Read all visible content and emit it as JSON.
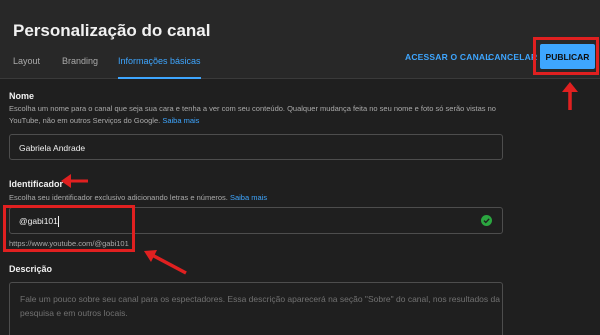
{
  "header": {
    "title": "Personalização do canal",
    "tabs": [
      {
        "label": "Layout",
        "active": false
      },
      {
        "label": "Branding",
        "active": false
      },
      {
        "label": "Informações básicas",
        "active": true
      }
    ],
    "view_channel_label": "ACESSAR O CANAL",
    "cancel_label": "CANCELAR",
    "publish_label": "PUBLICAR"
  },
  "name": {
    "title": "Nome",
    "help_line1": "Escolha um nome para o canal que seja sua cara e tenha a ver com seu conteúdo. Qualquer mudança feita no seu nome e foto só serão vistas no",
    "help_line2": "YouTube, não em outros Serviços do Google.",
    "learn_more": "Saiba mais",
    "value": "Gabriela Andrade"
  },
  "handle": {
    "title": "Identificador",
    "help": "Escolha seu identificador exclusivo adicionando letras e números.",
    "learn_more": "Saiba mais",
    "value": "@gabi101",
    "url": "https://www.youtube.com/@gabi101"
  },
  "description": {
    "title": "Descrição",
    "placeholder_line1": "Fale um pouco sobre seu canal para os espectadores. Essa descrição aparecerá na seção \"Sobre\" do canal, nos resultados da",
    "placeholder_line2": "pesquisa e em outros locais."
  },
  "colors": {
    "accent": "#3ea6ff",
    "annotation": "#e02020",
    "valid": "#2ba640"
  }
}
